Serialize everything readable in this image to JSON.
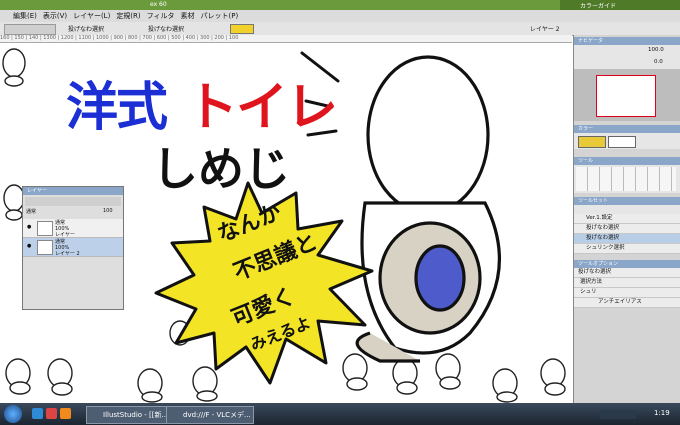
{
  "window": {
    "title_left": "ex 60",
    "title_right": "カラーガイド"
  },
  "menu": [
    "編集(E)",
    "表示(V)",
    "レイヤー(L)",
    "定規(R)",
    "フィルタ",
    "素材",
    "パレット(P)"
  ],
  "toolbar": {
    "tool_option_1": "投げなわ選択",
    "tool_option_2": "投げなわ選択",
    "layer_label": "レイヤー 2"
  },
  "ruler_ticks": "160 | 150 | 140 | 1300 | 1200 | 1100 | 1000 | 900 | 800 | 700 | 600 | 500 | 400 | 300 | 200 | 100",
  "artwork": {
    "title_word_1": "洋式",
    "title_word_2": "トイレ",
    "subtitle": "しめじ",
    "bubble_lines": [
      "なんか",
      "不思議と",
      "可愛く",
      "みえるよ"
    ],
    "colors": {
      "blue": "#1b2fd4",
      "red": "#e0141c",
      "bubble": "#f3e426",
      "toilet_bowl": "#4d5bcb"
    }
  },
  "dock": {
    "navigator": {
      "title": "ナビゲータ",
      "zoom": "100.0",
      "angle": "0.0"
    },
    "color": {
      "title": "カラー",
      "main_color": "#e8c93a",
      "sub_color": "#ffffff"
    },
    "tools": {
      "title": "ツール"
    },
    "toolset": {
      "title": "ツールセット",
      "items": [
        "Ver.1.設定",
        "投げなわ選択",
        "投げなわ選択",
        "シュリンク選択"
      ],
      "selected_index": 2
    },
    "tool_option": {
      "title": "ツールオプション",
      "tool_name": "投げなわ選択",
      "selection_method": "選択方法",
      "shrink": "シュリ",
      "anti_alias": "アンチエイリアス"
    }
  },
  "layer_palette": {
    "title": "レイヤー",
    "mode": "通常",
    "opacity": "100",
    "layers": [
      {
        "mode": "通常",
        "opacity": "100%",
        "name": "レイヤー"
      },
      {
        "mode": "通常",
        "opacity": "100%",
        "name": "レイヤー 2"
      }
    ]
  },
  "taskbar": {
    "app1": "IllustStudio - [[新...",
    "app2": "dvd:///F - VLCメデ...",
    "clock": "1:19"
  }
}
